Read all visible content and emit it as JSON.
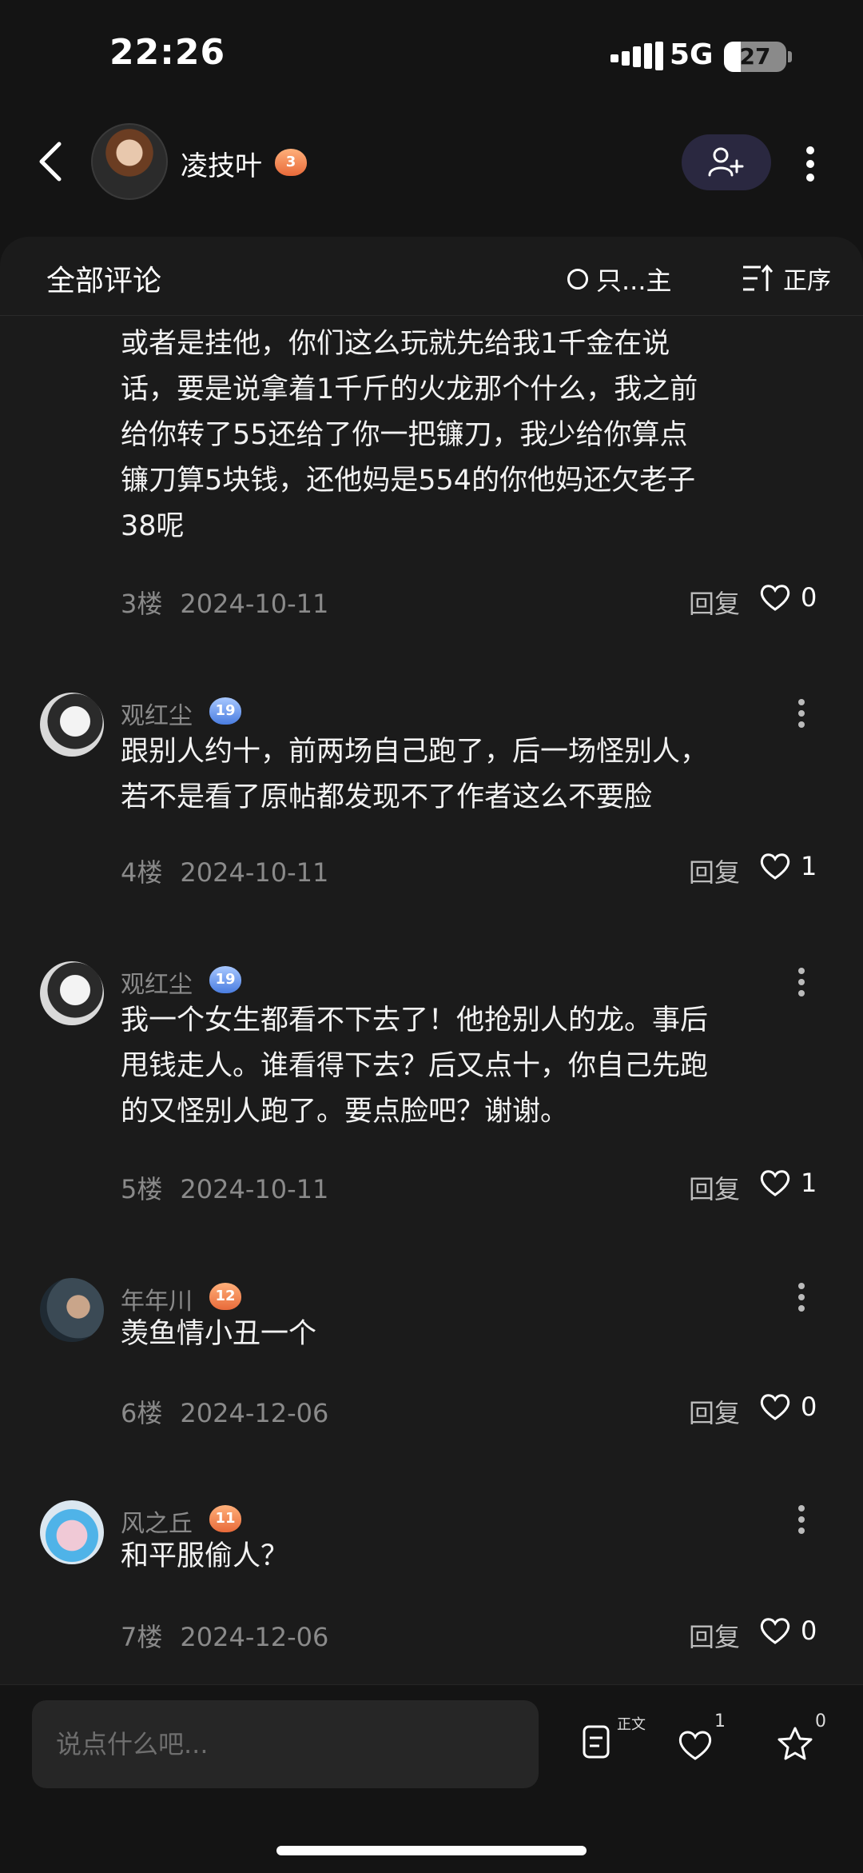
{
  "status_bar": {
    "time": "22:26",
    "network": "5G",
    "battery": "27"
  },
  "header": {
    "username": "凌技叶",
    "level": "3"
  },
  "panel": {
    "title": "全部评论",
    "filter_label": "只...主",
    "sort_label": "正序"
  },
  "comments": [
    {
      "name": "",
      "level": "",
      "text_lines": [
        "或者是挂他，你们这么玩就先给我1千金在说",
        "话，要是说拿着1千斤的火龙那个什么，我之前",
        "给你转了55还给了你一把镰刀，我少给你算点",
        "镰刀算5块钱，还他妈是554的你他妈还欠老子",
        "38呢"
      ],
      "floor": "3楼",
      "date": "2024-10-11",
      "reply": "回复",
      "likes": "0"
    },
    {
      "name": "观红尘",
      "level": "19",
      "text_lines": [
        "跟别人约十，前两场自己跑了，后一场怪别人，",
        "若不是看了原帖都发现不了作者这么不要脸"
      ],
      "floor": "4楼",
      "date": "2024-10-11",
      "reply": "回复",
      "likes": "1"
    },
    {
      "name": "观红尘",
      "level": "19",
      "text_lines": [
        "我一个女生都看不下去了！他抢别人的龙。事后",
        "甩钱走人。谁看得下去？后又点十，你自己先跑",
        "的又怪别人跑了。要点脸吧？谢谢。"
      ],
      "floor": "5楼",
      "date": "2024-10-11",
      "reply": "回复",
      "likes": "1"
    },
    {
      "name": "年年川",
      "level": "12",
      "text_lines": [
        "羡鱼情小丑一个"
      ],
      "floor": "6楼",
      "date": "2024-12-06",
      "reply": "回复",
      "likes": "0"
    },
    {
      "name": "风之丘",
      "level": "11",
      "text_lines": [
        "和平服偷人？"
      ],
      "floor": "7楼",
      "date": "2024-12-06",
      "reply": "回复",
      "likes": "0"
    }
  ],
  "bottom_bar": {
    "input_placeholder": "说点什么吧...",
    "body_label": "正文",
    "like_count": "1",
    "fav_count": "0"
  }
}
